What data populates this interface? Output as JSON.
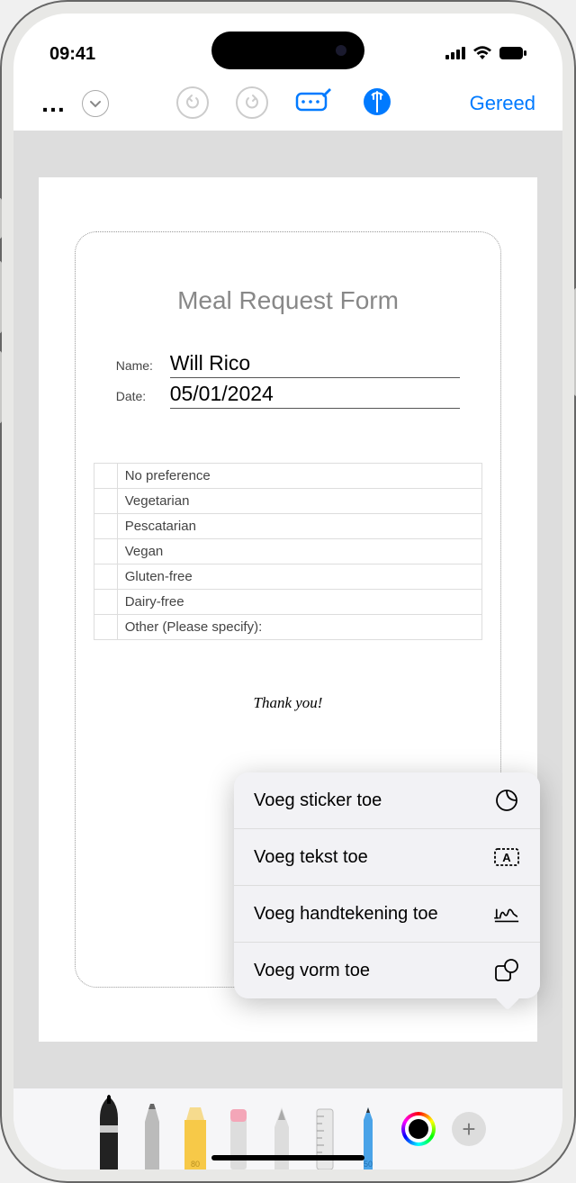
{
  "status": {
    "time": "09:41"
  },
  "toolbar": {
    "done": "Gereed"
  },
  "form": {
    "title": "Meal Request Form",
    "name_label": "Name:",
    "name_value": "Will Rico",
    "date_label": "Date:",
    "date_value": "05/01/2024",
    "options": [
      "No preference",
      "Vegetarian",
      "Pescatarian",
      "Vegan",
      "Gluten-free",
      "Dairy-free",
      "Other (Please specify):"
    ],
    "thanks": "Thank you!"
  },
  "popover": {
    "sticker": "Voeg sticker toe",
    "text": "Voeg tekst toe",
    "signature": "Voeg handtekening toe",
    "shape": "Voeg vorm toe"
  }
}
